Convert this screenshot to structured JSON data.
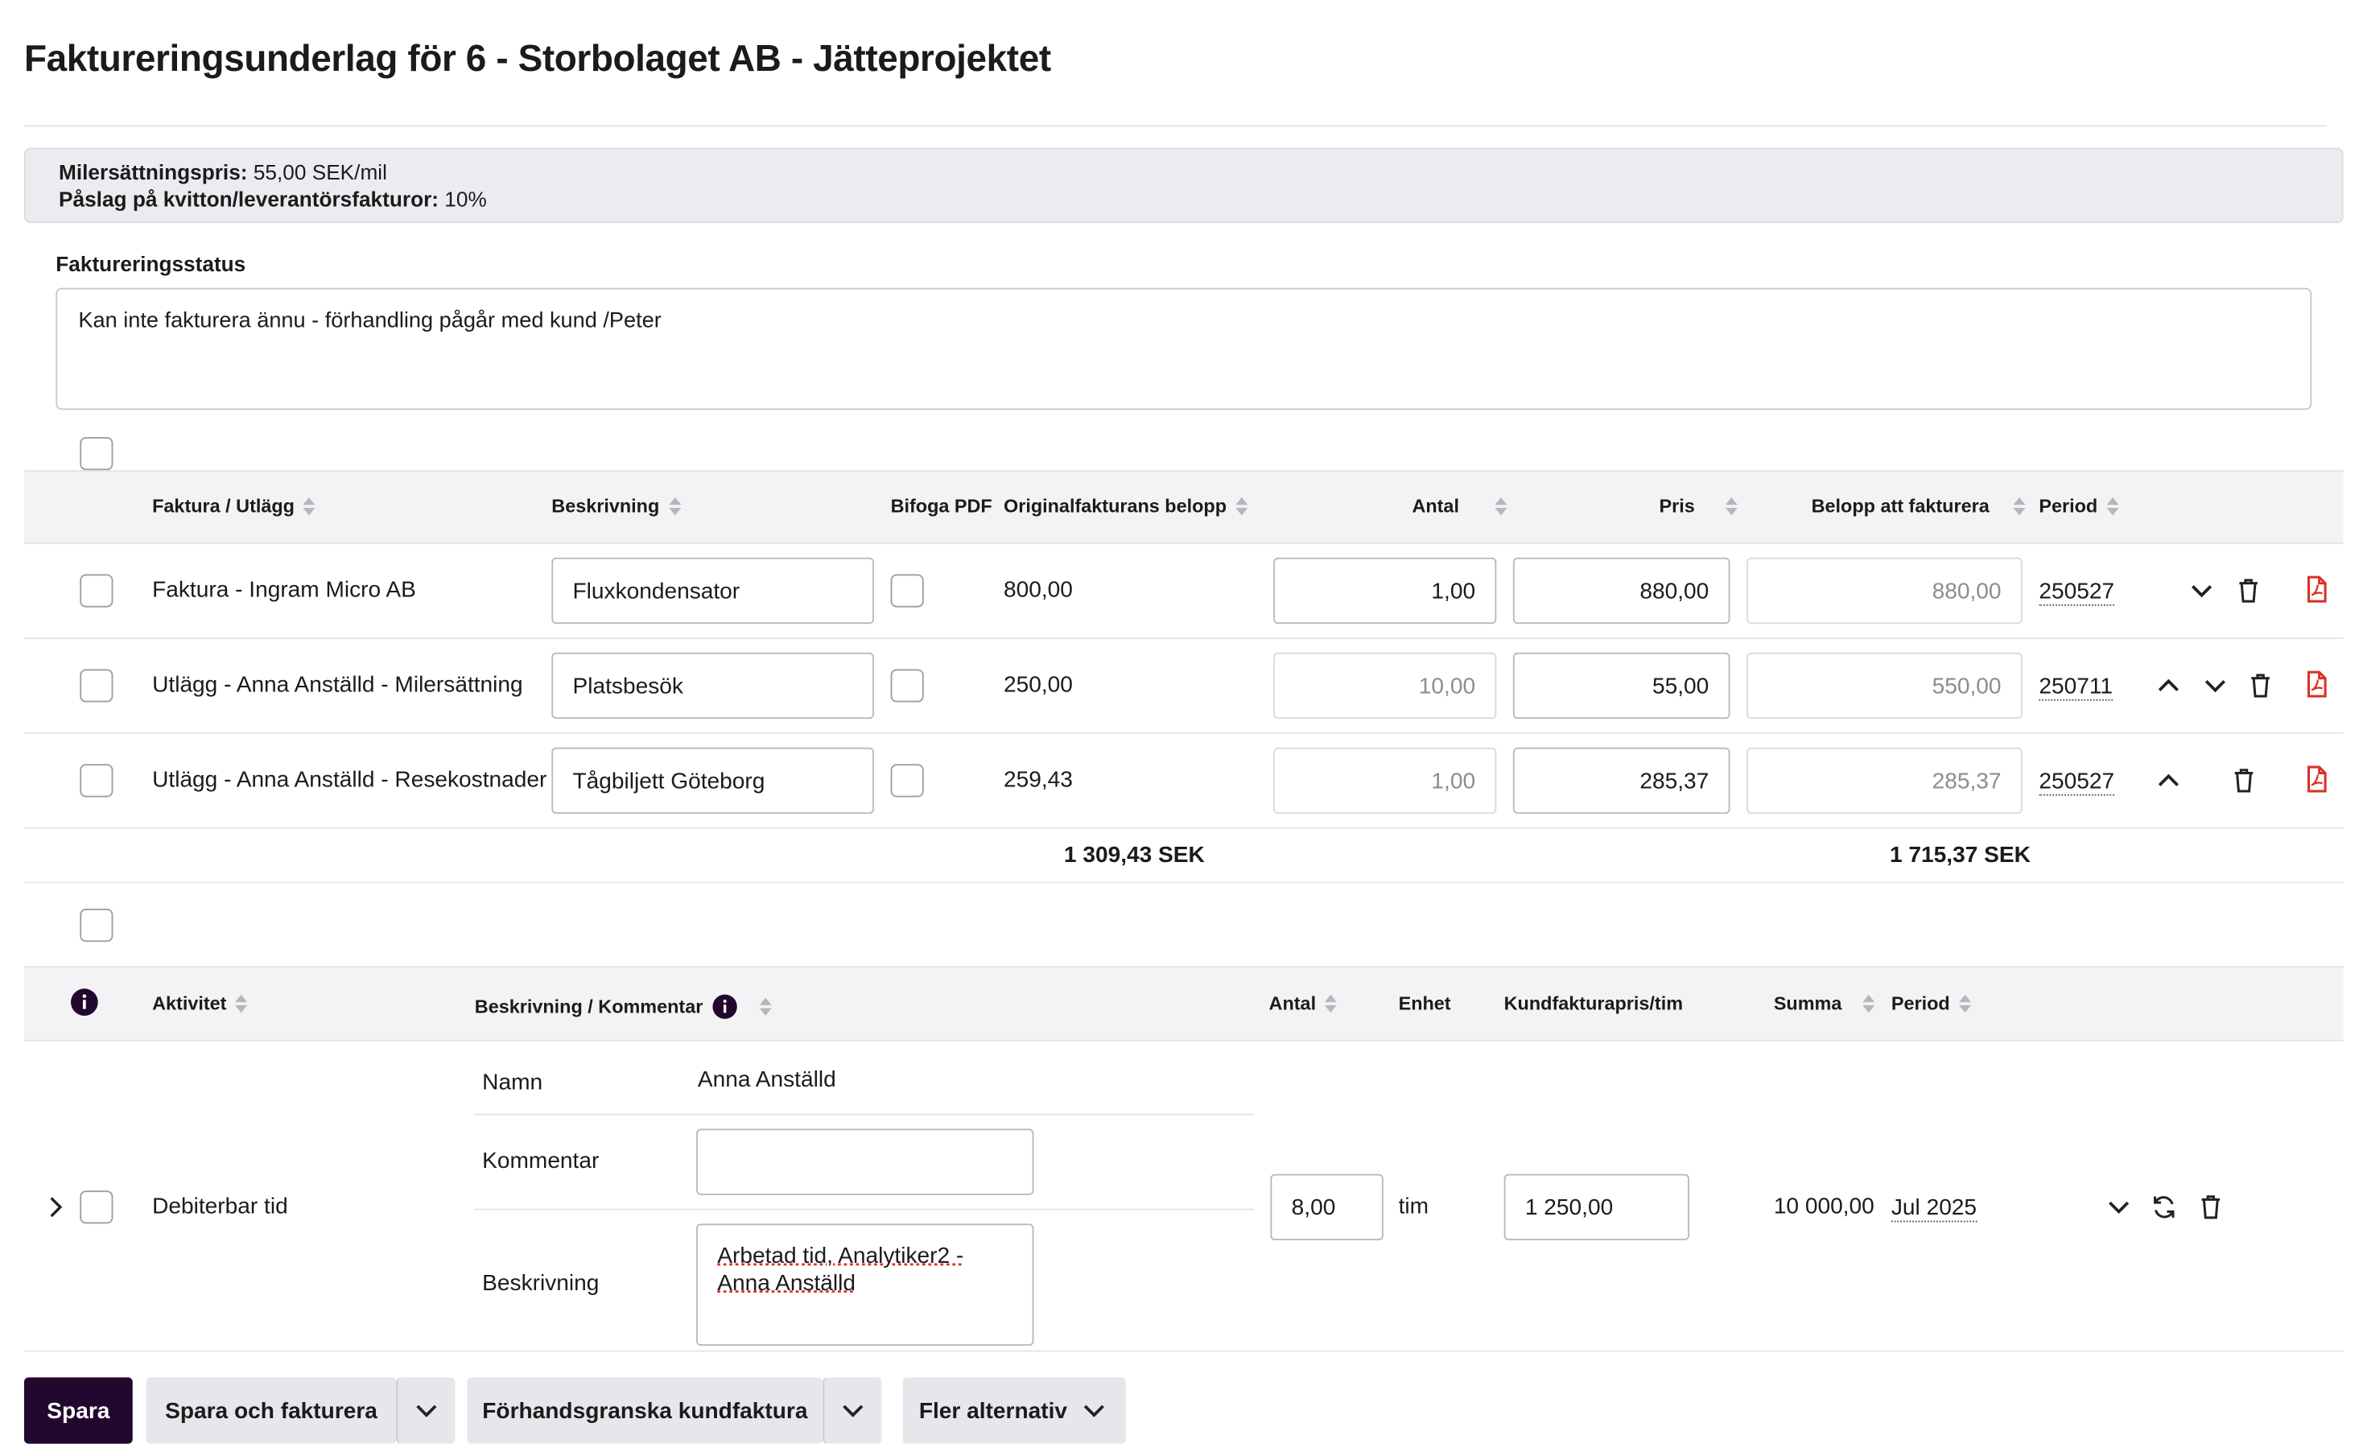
{
  "page_title": "Faktureringsunderlag för 6 - Storbolaget AB - Jätteprojektet",
  "info": {
    "mileage_label": "Milersättningspris:",
    "mileage_value": "55,00 SEK/mil",
    "markup_label": "Påslag på kvitton/leverantörsfakturor:",
    "markup_value": "10%"
  },
  "billing_status": {
    "label": "Faktureringsstatus",
    "value": "Kan inte fakturera ännu - förhandling pågår med kund /Peter"
  },
  "invoices_table": {
    "headers": {
      "type": "Faktura / Utlägg",
      "description": "Beskrivning",
      "attach_pdf": "Bifoga PDF",
      "original_amount": "Originalfakturans belopp",
      "quantity": "Antal",
      "price": "Pris",
      "amount_to_invoice": "Belopp att fakturera",
      "period": "Period"
    },
    "rows": [
      {
        "type": "Faktura - Ingram Micro AB",
        "description": "Fluxkondensator",
        "original_amount": "800,00",
        "quantity": "1,00",
        "price": "880,00",
        "amount": "880,00",
        "period": "250527"
      },
      {
        "type": "Utlägg - Anna Anställd - Milersättning",
        "description": "Platsbesök",
        "original_amount": "250,00",
        "quantity": "10,00",
        "price": "55,00",
        "amount": "550,00",
        "period": "250711"
      },
      {
        "type": "Utlägg - Anna Anställd - Resekostnader",
        "description": "Tågbiljett Göteborg",
        "original_amount": "259,43",
        "quantity": "1,00",
        "price": "285,37",
        "amount": "285,37",
        "period": "250527"
      }
    ],
    "total_original": "1 309,43 SEK",
    "total_to_invoice": "1 715,37 SEK"
  },
  "time_table": {
    "headers": {
      "activity": "Aktivitet",
      "description": "Beskrivning / Kommentar",
      "quantity": "Antal",
      "unit": "Enhet",
      "customer_price": "Kundfakturapris/tim",
      "sum": "Summa",
      "period": "Period"
    },
    "row": {
      "activity": "Debiterbar tid",
      "name_label": "Namn",
      "name_value": "Anna Anställd",
      "comment_label": "Kommentar",
      "comment_value": "",
      "description_label": "Beskrivning",
      "description_value": "Arbetad tid, Analytiker2 - Anna Anställd",
      "quantity": "8,00",
      "unit": "tim",
      "customer_price": "1 250,00",
      "sum": "10 000,00",
      "period": "Jul 2025"
    }
  },
  "footer": {
    "save": "Spara",
    "save_and_invoice": "Spara och fakturera",
    "preview_invoice": "Förhandsgranska kundfaktura",
    "more_options": "Fler alternativ"
  },
  "colors": {
    "primary_button": "#22082f",
    "secondary_button": "#e7e6eb",
    "pdf_icon": "#d93025",
    "info_background": "#ecebef"
  },
  "icons": [
    "chevron-down-icon",
    "chevron-up-icon",
    "trash-icon",
    "pdf-icon",
    "info-icon",
    "refresh-icon",
    "chevron-right-icon"
  ]
}
